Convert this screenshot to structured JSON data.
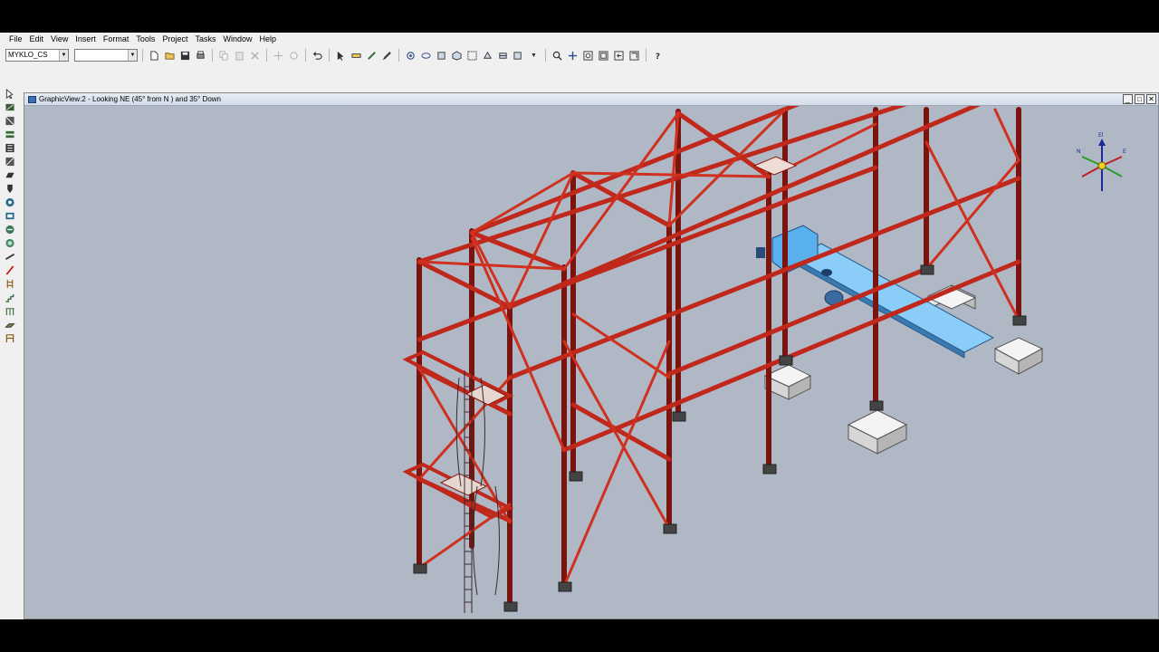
{
  "menu": [
    "File",
    "Edit",
    "View",
    "Insert",
    "Format",
    "Tools",
    "Project",
    "Tasks",
    "Window",
    "Help"
  ],
  "toolbar": {
    "coord_system": "MYKLO_CS",
    "filter_value": ""
  },
  "view": {
    "title": "GraphicView:2 - Looking NE (45° from N ) and 35° Down",
    "compass_labels": {
      "north": "N",
      "east": "E",
      "elevation": "El"
    }
  },
  "colors": {
    "steel": "#c0281c",
    "steel_dark": "#8a1810",
    "equipment": "#6fbaf0",
    "foundation": "#d0d0d0",
    "background": "#b0b8c6"
  }
}
